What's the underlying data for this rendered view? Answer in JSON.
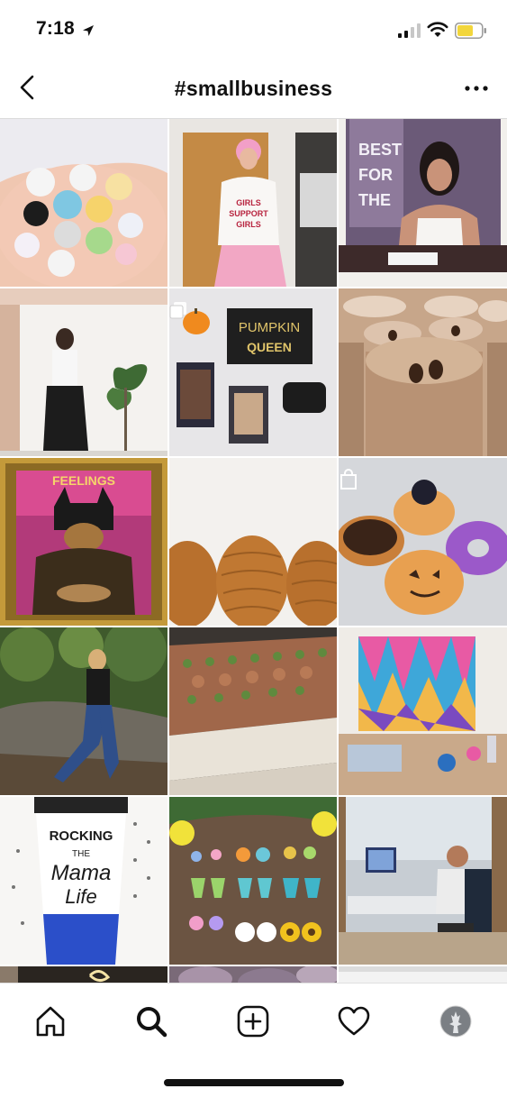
{
  "status_bar": {
    "time": "7:18",
    "icons": [
      "location-arrow-icon",
      "cellular-signal-icon",
      "wifi-icon",
      "battery-icon"
    ],
    "battery_color": "#f2d63c"
  },
  "header": {
    "title": "#smallbusiness",
    "back_icon": "chevron-left-icon",
    "more_icon": "more-horizontal-icon"
  },
  "grid": {
    "tiles": [
      {
        "subject": "kawaii-figurines",
        "overlay": "",
        "caption": ""
      },
      {
        "subject": "girls-support-girls-shirt",
        "overlay": "",
        "caption": "GIRLS SUPPORT GIRLS"
      },
      {
        "subject": "boss-woman-window",
        "overlay": "",
        "caption": "BE YOUR BEST FOR THE BOSS"
      },
      {
        "subject": "wide-pants-outfit",
        "overlay": "",
        "caption": ""
      },
      {
        "subject": "pumpkin-queen-flatlay",
        "overlay": "multiple-posts-icon",
        "caption": "PUMPKIN QUEEN"
      },
      {
        "subject": "coffee-whipped-jars",
        "overlay": "",
        "caption": ""
      },
      {
        "subject": "mona-lisa-batman-frame",
        "overlay": "",
        "caption": "FEELINGS"
      },
      {
        "subject": "yarn-skeins",
        "overlay": "",
        "caption": ""
      },
      {
        "subject": "halloween-donuts",
        "overlay": "shopping-bag-icon",
        "caption": ""
      },
      {
        "subject": "woman-on-rocks",
        "overlay": "",
        "caption": ""
      },
      {
        "subject": "soap-loaves",
        "overlay": "",
        "caption": ""
      },
      {
        "subject": "abstract-painting-studio",
        "overlay": "",
        "caption": ""
      },
      {
        "subject": "mama-life-tumbler",
        "overlay": "",
        "caption": "ROCKING THE Mama Life"
      },
      {
        "subject": "polymer-clay-earrings",
        "overlay": "",
        "caption": ""
      },
      {
        "subject": "man-at-desk",
        "overlay": "",
        "caption": ""
      },
      {
        "subject": "neon-sign-partial",
        "overlay": "",
        "caption": ""
      },
      {
        "subject": "succulents-partial",
        "overlay": "",
        "caption": ""
      },
      {
        "subject": "white-partial",
        "overlay": "",
        "caption": ""
      }
    ]
  },
  "tab_bar": {
    "items": [
      {
        "name": "home",
        "icon": "home-icon",
        "active": false
      },
      {
        "name": "search",
        "icon": "search-icon",
        "active": true
      },
      {
        "name": "new-post",
        "icon": "plus-square-icon",
        "active": false
      },
      {
        "name": "activity",
        "icon": "heart-icon",
        "active": false
      },
      {
        "name": "profile",
        "icon": "profile-avatar-icon",
        "active": false
      }
    ]
  },
  "colors": {
    "divider": "#dbdbdb",
    "text": "#111111",
    "background": "#ffffff"
  }
}
